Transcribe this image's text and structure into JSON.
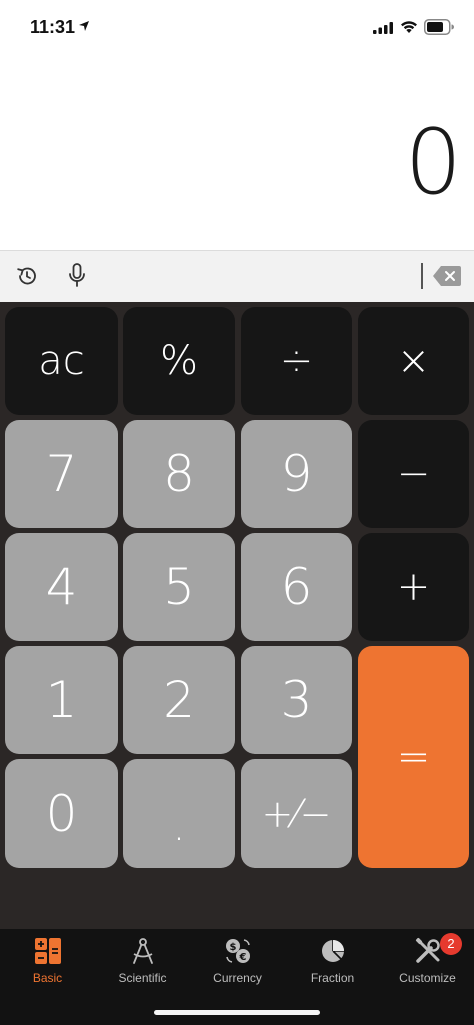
{
  "status_bar": {
    "time": "11:31"
  },
  "display": {
    "value": "0"
  },
  "keys": {
    "ac": "ac",
    "percent": "%",
    "divide": "÷",
    "multiply": "×",
    "seven": "7",
    "eight": "8",
    "nine": "9",
    "minus": "−",
    "four": "4",
    "five": "5",
    "six": "6",
    "plus": "+",
    "one": "1",
    "two": "2",
    "three": "3",
    "equals": "=",
    "zero": "0",
    "decimal": ".",
    "plus_minus": "+⁄−"
  },
  "tabs": [
    {
      "label": "Basic",
      "icon": "basic-icon",
      "active": true
    },
    {
      "label": "Scientific",
      "icon": "compass-icon"
    },
    {
      "label": "Currency",
      "icon": "currency-icon"
    },
    {
      "label": "Fraction",
      "icon": "pie-icon"
    },
    {
      "label": "Customize",
      "icon": "tools-icon",
      "badge": "2"
    }
  ],
  "colors": {
    "accent": "#ee7431",
    "key_dark": "#161616",
    "key_gray": "#a4a4a4",
    "keypad_bg": "#2b2726",
    "badge": "#e63a2e"
  }
}
